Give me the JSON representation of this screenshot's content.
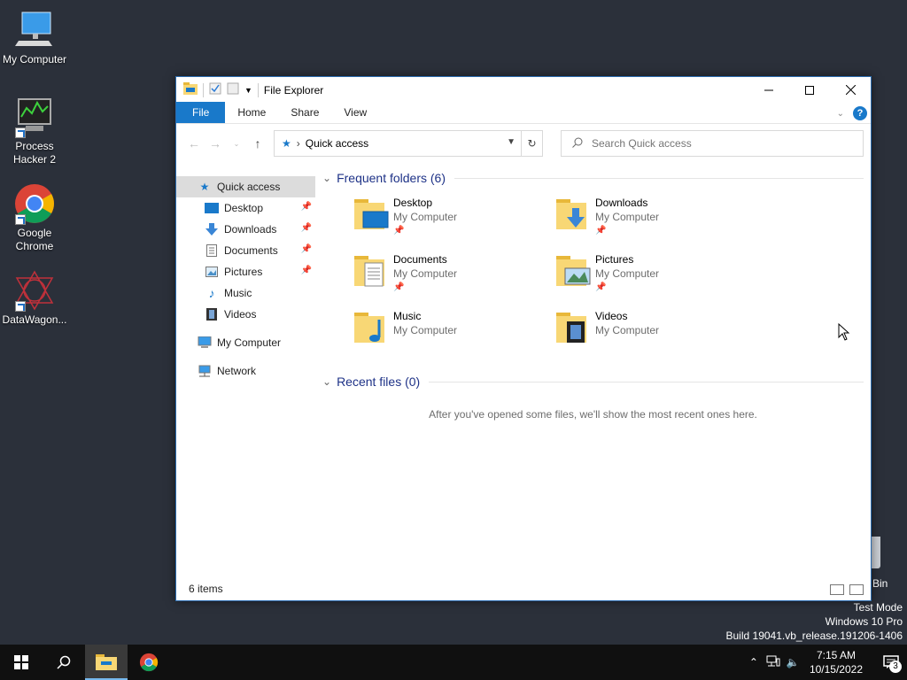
{
  "desktop": {
    "icons": [
      {
        "label": "My Computer"
      },
      {
        "label": "Process Hacker 2"
      },
      {
        "label": "Google Chrome"
      },
      {
        "label": "DataWagon..."
      }
    ],
    "recycle_label": "Bin",
    "watermark": {
      "line1": "Test Mode",
      "line2": "Windows 10 Pro",
      "line3": "Build 19041.vb_release.191206-1406"
    }
  },
  "window": {
    "title": "File Explorer",
    "ribbon_tabs": [
      "File",
      "Home",
      "Share",
      "View"
    ],
    "address": {
      "crumb": "Quick access"
    },
    "search": {
      "placeholder": "Search Quick access"
    },
    "sidebar": {
      "quick_access": "Quick access",
      "pinned": [
        {
          "label": "Desktop",
          "pinned": true
        },
        {
          "label": "Downloads",
          "pinned": true
        },
        {
          "label": "Documents",
          "pinned": true
        },
        {
          "label": "Pictures",
          "pinned": true
        },
        {
          "label": "Music",
          "pinned": false
        },
        {
          "label": "Videos",
          "pinned": false
        }
      ],
      "my_computer": "My Computer",
      "network": "Network"
    },
    "frequent": {
      "heading": "Frequent folders (6)",
      "folders": [
        {
          "name": "Desktop",
          "location": "My Computer"
        },
        {
          "name": "Downloads",
          "location": "My Computer"
        },
        {
          "name": "Documents",
          "location": "My Computer"
        },
        {
          "name": "Pictures",
          "location": "My Computer"
        },
        {
          "name": "Music",
          "location": "My Computer"
        },
        {
          "name": "Videos",
          "location": "My Computer"
        }
      ]
    },
    "recent": {
      "heading": "Recent files (0)",
      "empty_message": "After you've opened some files, we'll show the most recent ones here."
    },
    "status": "6 items"
  },
  "taskbar": {
    "clock_time": "7:15 AM",
    "clock_date": "10/15/2022",
    "notification_count": "3"
  },
  "colors": {
    "accent": "#1979ca",
    "desktop_bg": "#2b303a",
    "taskbar_bg": "#101010",
    "folder_yellow": "#f8d775"
  }
}
